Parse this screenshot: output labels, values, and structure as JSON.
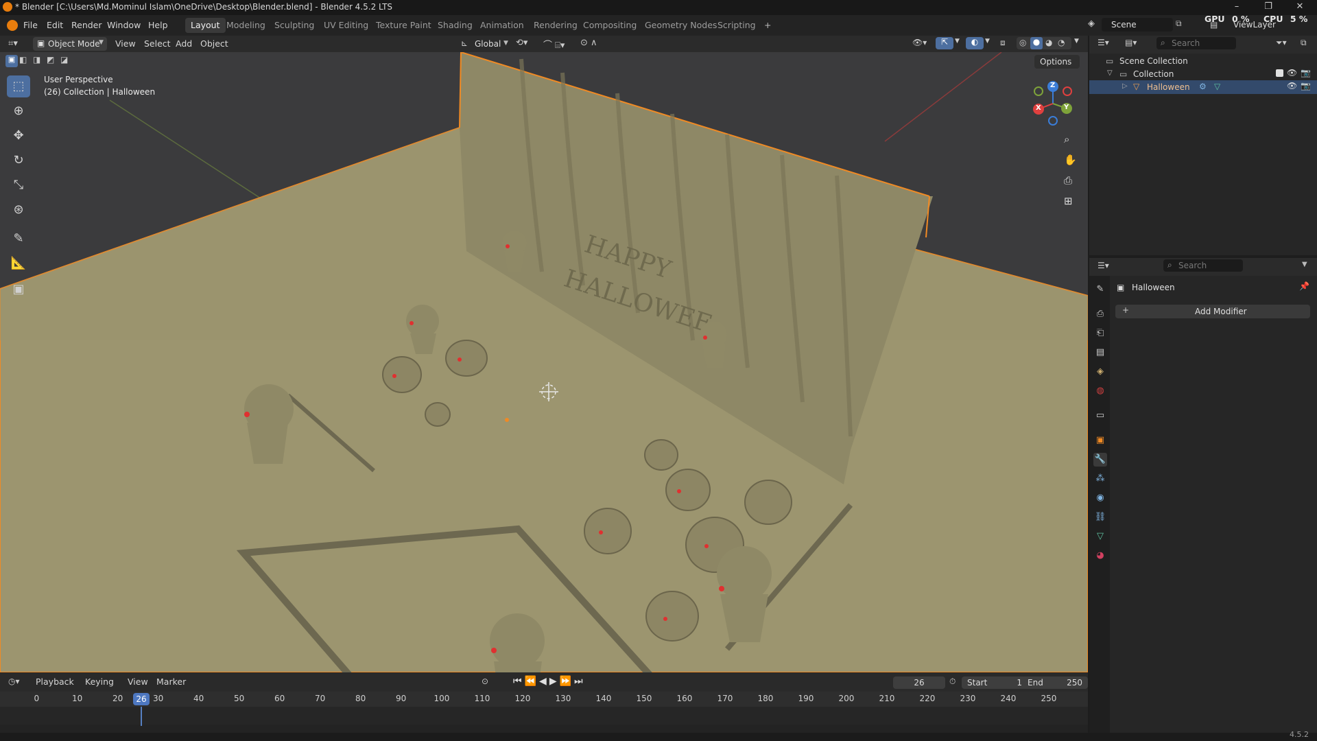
{
  "window": {
    "title": "* Blender [C:\\Users\\Md.Mominul Islam\\OneDrive\\Desktop\\Blender.blend] - Blender 4.5.2 LTS",
    "controls": [
      "–",
      "❐",
      "✕"
    ]
  },
  "menu": {
    "items": [
      "File",
      "Edit",
      "Render",
      "Window",
      "Help"
    ]
  },
  "workspaces": {
    "tabs": [
      "Layout",
      "Modeling",
      "Sculpting",
      "UV Editing",
      "Texture Paint",
      "Shading",
      "Animation",
      "Rendering",
      "Compositing",
      "Geometry Nodes",
      "Scripting"
    ],
    "active": "Layout",
    "add": "+"
  },
  "top_right": {
    "scene_label": "Scene",
    "viewlayer_label": "ViewLayer",
    "gpu": "GPU",
    "gpu_value": "0 %",
    "cpu": "CPU",
    "cpu_value": "5 %"
  },
  "viewport_header": {
    "mode": "Object Mode",
    "menus": [
      "View",
      "Select",
      "Add",
      "Object"
    ],
    "transform": "Global",
    "options": "Options"
  },
  "viewport": {
    "perspective": "User Perspective",
    "collection_info": "(26) Collection | Halloween",
    "gizmo_axes": {
      "x": "X",
      "y": "Y",
      "z": "Z"
    }
  },
  "outliner": {
    "search_placeholder": "Search",
    "scene_collection": "Scene Collection",
    "collection": "Collection",
    "object": "Halloween"
  },
  "properties": {
    "search_placeholder": "Search",
    "object_name": "Halloween",
    "add_modifier": "Add Modifier"
  },
  "timeline": {
    "menus": [
      "Playback",
      "Keying",
      "View",
      "Marker"
    ],
    "current_frame": "26",
    "start_label": "Start",
    "start_value": "1",
    "end_label": "End",
    "end_value": "250",
    "ticks": [
      "0",
      "10",
      "20",
      "26",
      "30",
      "40",
      "50",
      "60",
      "70",
      "80",
      "90",
      "100",
      "110",
      "120",
      "130",
      "140",
      "150",
      "160",
      "170",
      "180",
      "190",
      "200",
      "210",
      "220",
      "230",
      "240",
      "250"
    ],
    "playhead_label": "26"
  },
  "status": {
    "version": "4.5.2"
  },
  "colors": {
    "accent_blue": "#4d6fa0",
    "selection_orange": "#f08a24",
    "scene_ground": "#9b9470",
    "axis_red": "#e0403f",
    "axis_green": "#7ea33a"
  }
}
